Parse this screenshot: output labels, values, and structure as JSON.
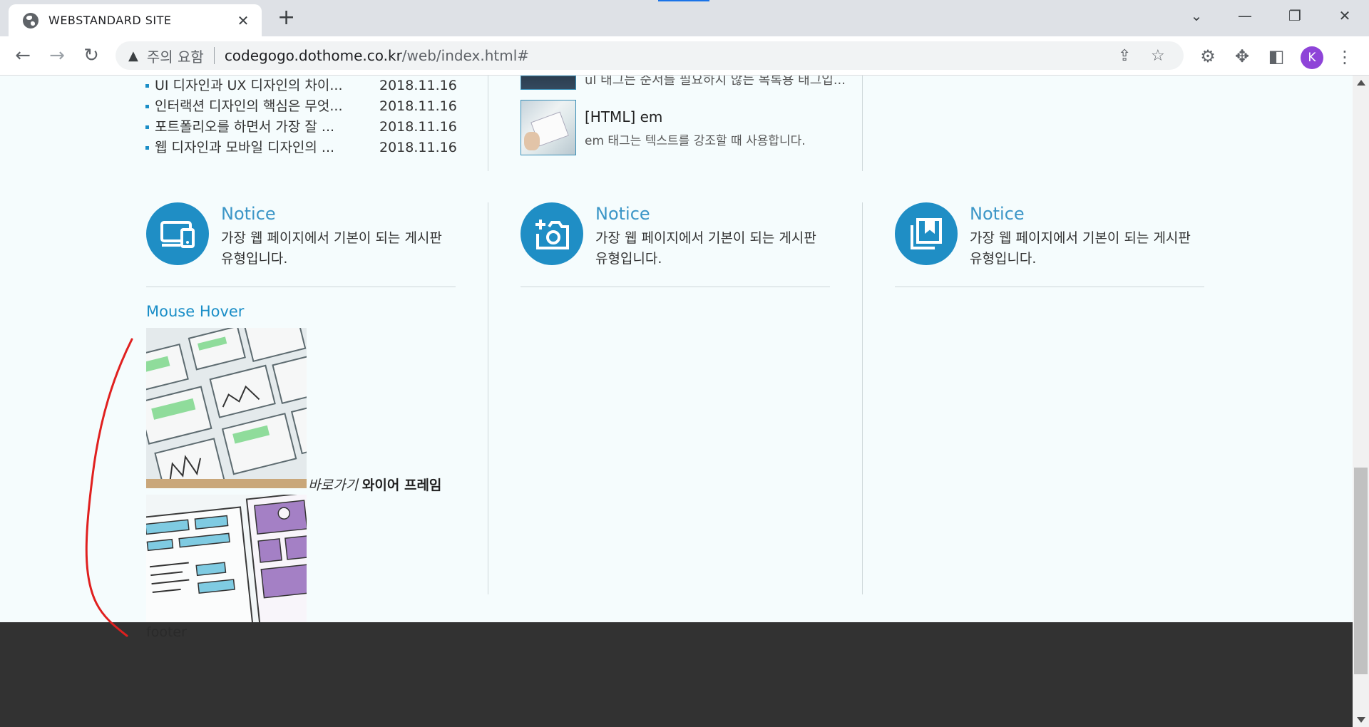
{
  "browser": {
    "tab_title": "WEBSTANDARD SITE",
    "tab_close": "✕",
    "new_tab": "+",
    "security_label": "주의 요함",
    "url_host": "codegogo.dothome.co.kr",
    "url_path": "/web/index.html#",
    "avatar_letter": "K",
    "controls": {
      "tab_search": "⌄",
      "minimize": "—",
      "restore": "❐",
      "close": "✕"
    },
    "accent_color": "#1a73e8"
  },
  "news": [
    {
      "title": "UI 디자인과 UX 디자인의 차이...",
      "date": "2018.11.16"
    },
    {
      "title": "인터랙션 디자인의 핵심은 무엇...",
      "date": "2018.11.16"
    },
    {
      "title": "포트폴리오를 하면서 가장 잘 ...",
      "date": "2018.11.16"
    },
    {
      "title": "웹 디자인과 모바일 디자인의 ...",
      "date": "2018.11.16"
    }
  ],
  "articles": {
    "cut_text": "ul 태그는 순서를 필요하지 않는 목록용 태그입...",
    "em_title": "[HTML] em",
    "em_desc": "em 태그는 텍스트를 강조할 때 사용합니다."
  },
  "notices": [
    {
      "title": "Notice",
      "text": "가장 웹 페이지에서 기본이 되는 게시판 유형입니다.",
      "icon": "devices-icon"
    },
    {
      "title": "Notice",
      "text": "가장 웹 페이지에서 기본이 되는 게시판 유형입니다.",
      "icon": "add-camera-icon"
    },
    {
      "title": "Notice",
      "text": "가장 웹 페이지에서 기본이 되는 게시판 유형입니다.",
      "icon": "bookmark-library-icon"
    }
  ],
  "mouse_hover": {
    "title": "Mouse Hover",
    "caption_em": "바로가기",
    "caption_strong": "와이어 프레임"
  },
  "footer": {
    "label": "footer",
    "color": "#323232"
  },
  "theme": {
    "primary": "#1f8ec5",
    "page_bg": "#f5fcfd",
    "annotation": "#e0201f"
  }
}
